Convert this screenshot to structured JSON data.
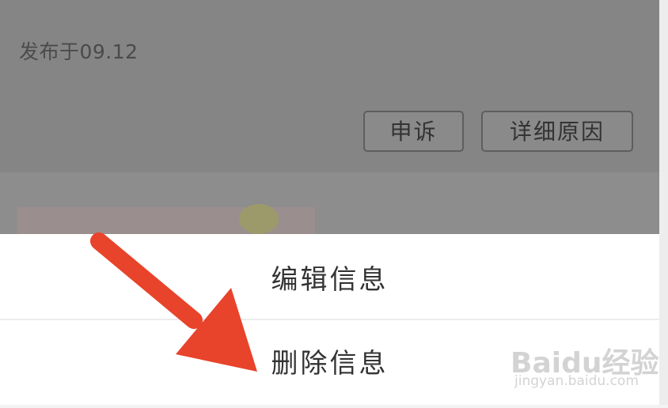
{
  "background_screen": {
    "publish_date": "发布于09.12",
    "buttons": {
      "appeal": "申诉",
      "detail_reason": "详细原因"
    }
  },
  "action_sheet": {
    "items": [
      {
        "label": "编辑信息"
      },
      {
        "label": "删除信息"
      }
    ]
  },
  "watermark": {
    "logo": "Baidu经验",
    "url": "jingyan.baidu.com"
  },
  "colors": {
    "overlay": "#8d8d8d",
    "sheet": "#ffffff",
    "arrow": "#e8432b",
    "text": "#333333"
  },
  "icons": {
    "annotation": "red-arrow-icon"
  }
}
